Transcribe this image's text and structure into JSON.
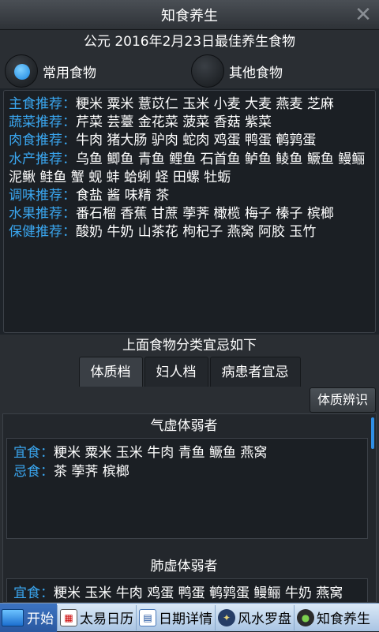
{
  "app": {
    "title": "知食养生"
  },
  "date_line": "公元 2016年2月23日最佳养生食物",
  "radios": [
    {
      "label": "常用食物",
      "selected": true
    },
    {
      "label": "其他食物",
      "selected": false
    }
  ],
  "food_categories": [
    {
      "label": "主食推荐：",
      "items": "粳米 粟米 薏苡仁 玉米 小麦 大麦 燕麦 芝麻"
    },
    {
      "label": "蔬菜推荐：",
      "items": "芹菜 芸薹 金花菜 菠菜 香菇 紫菜"
    },
    {
      "label": "肉食推荐：",
      "items": "牛肉 猪大肠 驴肉 蛇肉 鸡蛋 鸭蛋 鹌鹑蛋"
    },
    {
      "label": "水产推荐：",
      "items": "乌鱼 鲫鱼 青鱼 鲤鱼 石首鱼 鲈鱼 鲮鱼 鳜鱼 鳗鲡 泥鳅 鲑鱼 蟹 蚬 蚌 蛤蜊 蛏 田螺 牡蛎"
    },
    {
      "label": "调味推荐：",
      "items": "食盐 酱 味精 茶"
    },
    {
      "label": "水果推荐：",
      "items": "番石榴 香蕉 甘蔗 荸荠 橄榄 梅子 榛子 槟榔"
    },
    {
      "label": "保健推荐：",
      "items": "酸奶 牛奶 山茶花 枸杞子 燕窝 阿胶 玉竹"
    }
  ],
  "section_title": "上面食物分类宜忌如下",
  "tabs": [
    {
      "label": "体质档",
      "active": true
    },
    {
      "label": "妇人档",
      "active": false
    },
    {
      "label": "病患者宜忌",
      "active": false
    }
  ],
  "identify_button": "体质辨识",
  "groups": [
    {
      "title": "气虚体弱者",
      "suitable_label": "宜食：",
      "suitable": "粳米 粟米 玉米 牛肉 青鱼 鳜鱼 燕窝",
      "avoid_label": "忌食：",
      "avoid": "茶 荸荠 槟榔"
    },
    {
      "title": "肺虚体弱者",
      "suitable_label": "宜食：",
      "suitable": "粳米 玉米 牛肉 鸡蛋 鸭蛋 鹌鹑蛋 鳗鲡 牛奶 燕窝"
    }
  ],
  "taskbar": {
    "start": "开始",
    "tasks": [
      {
        "label": "太易日历",
        "icon": "calendar-icon"
      },
      {
        "label": "日期详情",
        "icon": "date-icon"
      },
      {
        "label": "风水罗盘",
        "icon": "compass-icon"
      },
      {
        "label": "知食养生",
        "icon": "food-icon"
      }
    ]
  }
}
